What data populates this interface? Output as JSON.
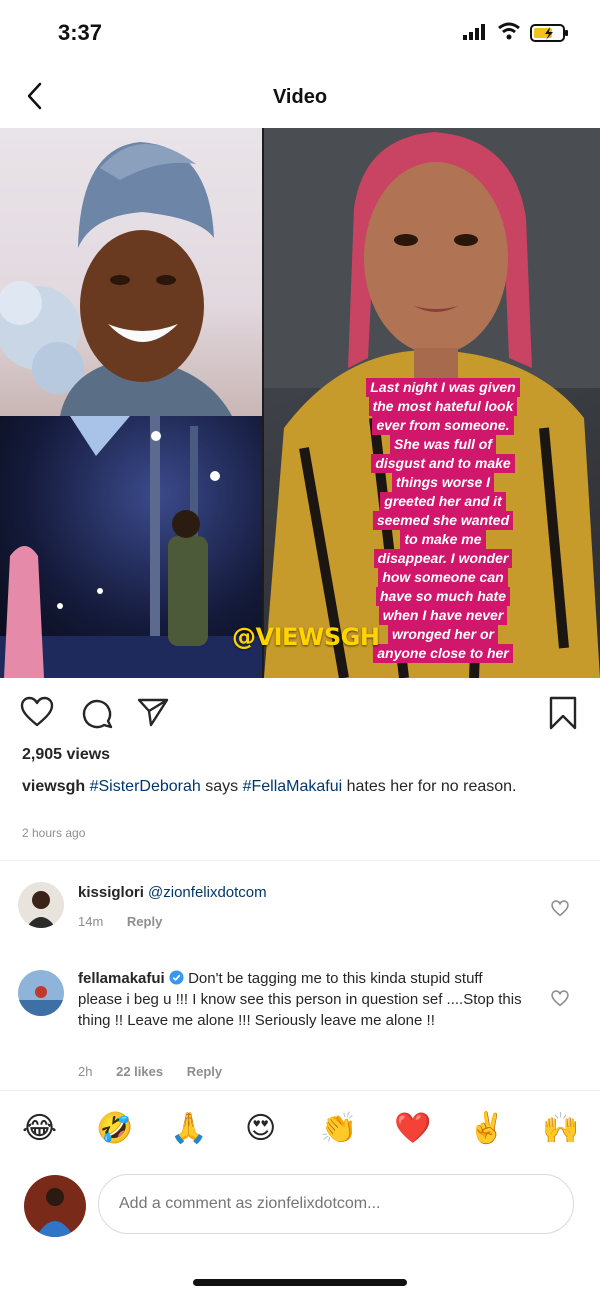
{
  "status_bar": {
    "time": "3:37"
  },
  "nav": {
    "title": "Video"
  },
  "media": {
    "watermark": "@VIEWSGH",
    "caption_lines": [
      "Last night I was given",
      "the most hateful look",
      "ever from someone.",
      "She was full of",
      "disgust and to make",
      "things worse I",
      "greeted her and it",
      "seemed she wanted",
      "to make me",
      "disappear. I wonder",
      "how someone can",
      "have so much hate",
      "when I have never",
      "wronged her or",
      "anyone close to her"
    ]
  },
  "post": {
    "views": "2,905 views",
    "username": "viewsgh",
    "tag1": "#SisterDeborah",
    "mid_text": " says ",
    "tag2": "#FellaMakafui",
    "end_text": " hates her for no reason.",
    "time_ago": "2 hours ago"
  },
  "comments": [
    {
      "username": "kissiglori",
      "mention": "@zionfelixdotcom",
      "text": "",
      "time": "14m",
      "likes": "",
      "reply": "Reply"
    },
    {
      "username": "fellamakafui",
      "mention": "",
      "text": "Don't be tagging me to this kinda stupid stuff please i beg u !!! I know see this person in question sef ....Stop this thing !! Leave me alone !!! Seriously leave me alone !!",
      "time": "2h",
      "likes": "22 likes",
      "reply": "Reply"
    }
  ],
  "emoji_bar": [
    "😂",
    "🤣",
    "🙏",
    "😍",
    "👏",
    "❤️",
    "✌️",
    "🙌"
  ],
  "compose": {
    "placeholder": "Add a comment as zionfelixdotcom..."
  },
  "colors": {
    "caption_bg": "#d1176b",
    "watermark": "#ffd400",
    "verified": "#3897f0",
    "heart_red": "#e0182d"
  }
}
